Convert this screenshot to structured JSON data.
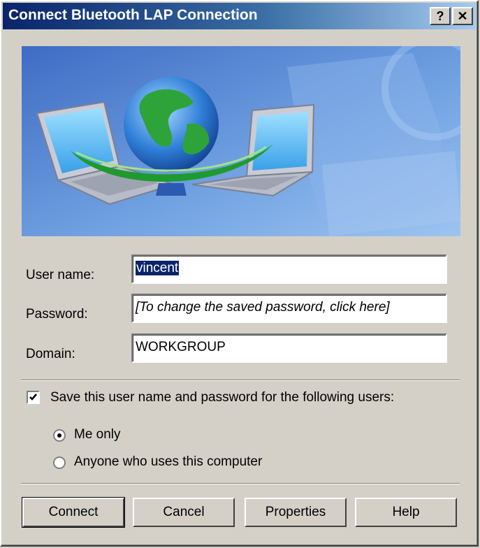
{
  "window": {
    "title": "Connect Bluetooth LAP Connection",
    "help_button": "?",
    "close_button": "✕"
  },
  "banner": {
    "description_icon": "network-globe-laptops"
  },
  "form": {
    "user_name_label": "User name:",
    "user_name_value": "vincent",
    "password_label": "Password:",
    "password_value": "[To change the saved password, click here]",
    "domain_label": "Domain:",
    "domain_value": "WORKGROUP"
  },
  "save": {
    "checkbox_label": "Save this user name and password for the following users:",
    "checked": true,
    "options": [
      {
        "label": "Me only",
        "selected": true
      },
      {
        "label": "Anyone who uses this computer",
        "selected": false
      }
    ]
  },
  "buttons": {
    "connect": "Connect",
    "cancel": "Cancel",
    "properties": "Properties",
    "help": "Help"
  },
  "colors": {
    "title_bar_start": "#0a246a",
    "title_bar_end": "#a6caf0",
    "dialog_bg": "#d4d0c8",
    "selection": "#0a246a"
  }
}
